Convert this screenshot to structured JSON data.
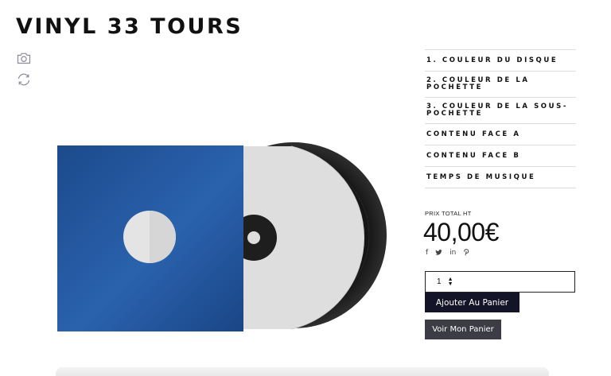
{
  "product": {
    "title": "VINYL 33 TOURS",
    "price_label": "PRIX TOTAL HT",
    "price": "40,00€"
  },
  "tools": {
    "camera_icon": "camera-icon",
    "rotate_icon": "rotate-icon"
  },
  "options": [
    {
      "label": "1. COULEUR DU DISQUE"
    },
    {
      "label": "2. COULEUR DE LA POCHETTE"
    },
    {
      "label": "3. COULEUR DE LA SOUS-POCHETTE"
    },
    {
      "label": "CONTENU FACE A"
    },
    {
      "label": "CONTENU FACE B"
    },
    {
      "label": "TEMPS DE MUSIQUE"
    }
  ],
  "share": {
    "facebook": "f",
    "twitter": "twitter-icon",
    "linkedin": "in",
    "pinterest": "pinterest-icon"
  },
  "quantity": {
    "value": "1"
  },
  "buttons": {
    "add_to_cart": "Ajouter Au Panier",
    "view_cart": "Voir Mon Panier"
  },
  "colors": {
    "sleeve": "#1f4f93",
    "inner_sleeve": "#dcdcdc",
    "disc": "#1c1c1c",
    "add_button": "#141428",
    "view_button": "#3c3c44"
  }
}
